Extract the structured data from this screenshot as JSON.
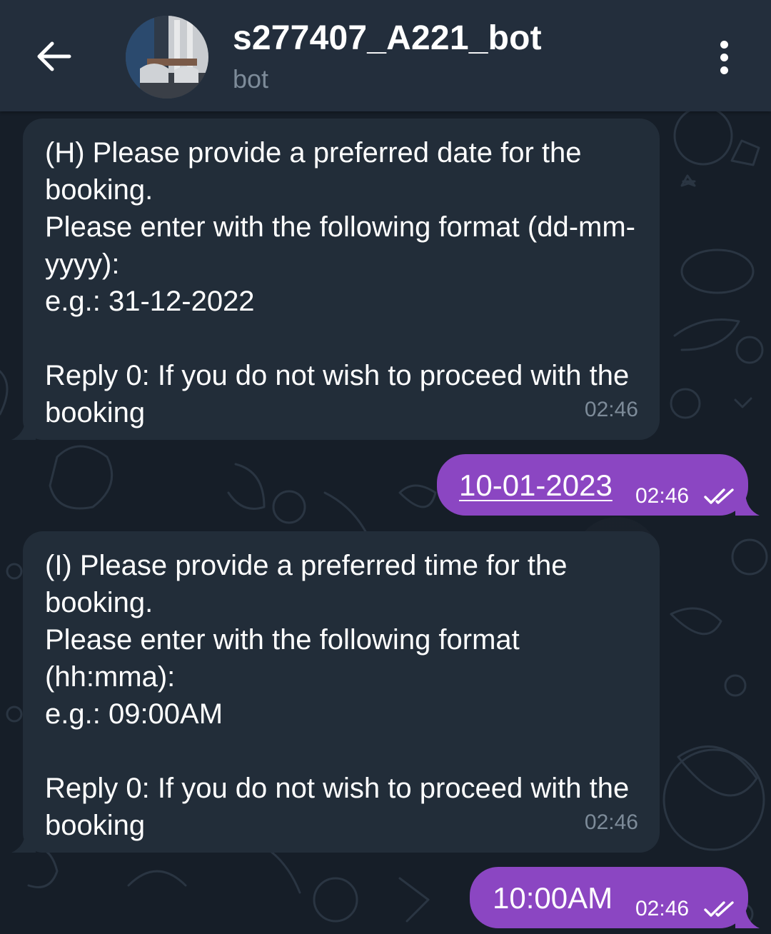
{
  "header": {
    "title": "s277407_A221_bot",
    "subtitle": "bot",
    "back_icon": "arrow-left-icon",
    "menu_icon": "more-vertical-icon"
  },
  "colors": {
    "header_bg": "#232e3c",
    "chat_bg": "#161e28",
    "incoming_bubble": "#222d39",
    "outgoing_bubble": "#8b46c2",
    "muted_text": "#7d8b99"
  },
  "messages": [
    {
      "direction": "incoming",
      "text": "(H) Please provide a preferred date for the booking.\nPlease enter with the following format (dd-mm-yyyy):\ne.g.: 31-12-2022\n\nReply 0: If you do not wish to proceed with the booking",
      "time": "02:46"
    },
    {
      "direction": "outgoing",
      "text": "10-01-2023",
      "time": "02:46",
      "status": "read",
      "status_icon": "double-check-icon"
    },
    {
      "direction": "incoming",
      "text": "(I) Please provide a preferred time for the booking.\nPlease enter with the following format (hh:mma):\ne.g.: 09:00AM\n\nReply 0: If you do not wish to proceed with the booking",
      "time": "02:46"
    },
    {
      "direction": "outgoing",
      "text": "10:00AM",
      "time": "02:46",
      "status": "read",
      "status_icon": "double-check-icon"
    }
  ]
}
